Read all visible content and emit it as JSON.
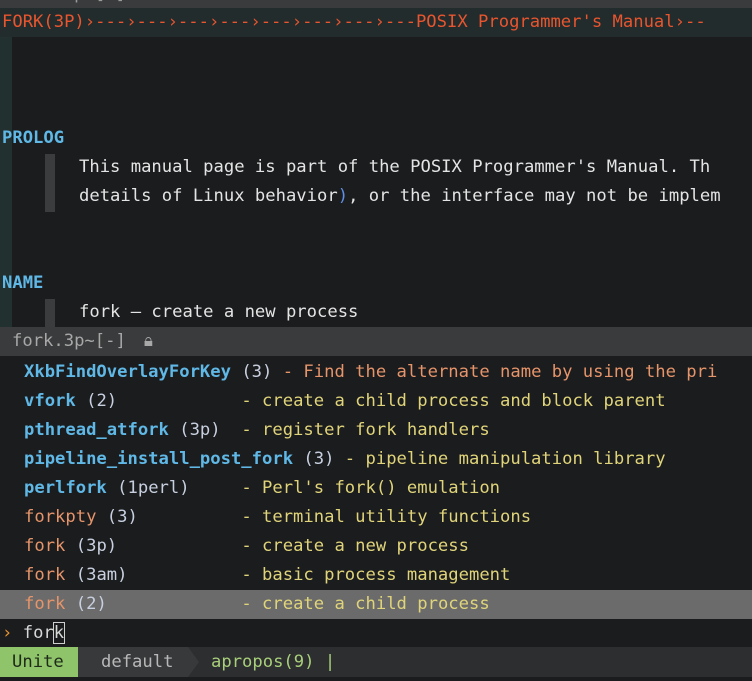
{
  "top_window": {
    "title": "fork.3p [-]"
  },
  "editor": {
    "header": {
      "left": "FORK(3P)",
      "center": "POSIX Programmer's Manual"
    },
    "sections": [
      {
        "heading": "PROLOG",
        "lines": [
          "This manual page is part of the POSIX Programmer's Manual. Th",
          "details of Linux behavior), or the interface may not be implem"
        ]
      },
      {
        "heading": "NAME",
        "lines": [
          "fork — create a new process"
        ]
      }
    ]
  },
  "statusline": {
    "filename": "fork.3p~[-]",
    "lock_icon": "lock-icon"
  },
  "unite": {
    "items": [
      {
        "name": "XkbFindOverlayForKey",
        "section": "(3)",
        "desc": "- Find the alternate name by using the pri",
        "style": "blue",
        "desc_color": "orange"
      },
      {
        "name": "vfork",
        "section": "(2)",
        "desc": "- create a child process and block parent",
        "style": "blue",
        "desc_color": "yellow"
      },
      {
        "name": "pthread_atfork",
        "section": "(3p)",
        "desc": "- register fork handlers",
        "style": "blue",
        "desc_color": "yellow"
      },
      {
        "name": "pipeline_install_post_fork",
        "section": "(3)",
        "desc": "- pipeline manipulation library",
        "style": "blue",
        "desc_color": "yellow"
      },
      {
        "name": "perlfork",
        "section": "(1perl)",
        "desc": "- Perl's fork() emulation",
        "style": "blue",
        "desc_color": "yellow"
      },
      {
        "name": "forkpty",
        "section": "(3)",
        "desc": "- terminal utility functions",
        "style": "orange",
        "desc_color": "yellow"
      },
      {
        "name": "fork",
        "section": "(3p)",
        "desc": "- create a new process",
        "style": "orange",
        "desc_color": "yellow"
      },
      {
        "name": "fork",
        "section": "(3am)",
        "desc": "- basic process management",
        "style": "orange",
        "desc_color": "yellow"
      },
      {
        "name": "fork",
        "section": "(2)",
        "desc": "- create a child process",
        "style": "orange",
        "desc_color": "yellow",
        "selected": true
      }
    ],
    "prompt": {
      "caret": "›",
      "input": "fork"
    },
    "bar": {
      "mode": "Unite",
      "buffer": "default",
      "source": "apropos(9) |"
    }
  },
  "colors": {
    "header": "#e8552f",
    "keyword": "#5fb8e6",
    "yellow": "#e0d47a",
    "orange": "#e6946a",
    "mode_bg": "#8fc46a"
  }
}
